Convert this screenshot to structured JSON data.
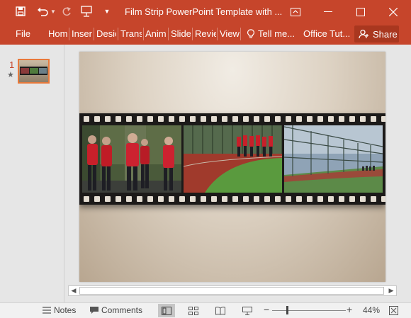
{
  "window": {
    "title": "Film Strip PowerPoint Template with ...",
    "colors": {
      "accent": "#c6452b",
      "share_bg": "#a9371f",
      "thumb_border": "#e8793b"
    },
    "controls": [
      "ribbon-display-options-icon",
      "minimize-icon",
      "maximize-icon",
      "close-icon"
    ]
  },
  "quick_access": [
    "save-icon",
    "undo-icon",
    "redo-icon",
    "start-from-beginning-icon",
    "customize-icon"
  ],
  "ribbon": {
    "tabs": [
      "File",
      "Hom",
      "Inser",
      "Desic",
      "Trans",
      "Anim",
      "Slide",
      "Revie",
      "View"
    ],
    "tell_me": "Tell me...",
    "office_tutorials": "Office Tut...",
    "share": "Share"
  },
  "thumbnails": [
    {
      "number": "1",
      "has_animation": true,
      "selected": true
    }
  ],
  "slide": {
    "frames": [
      {
        "scene": "runners-portrait"
      },
      {
        "scene": "track-field"
      },
      {
        "scene": "fence-perspective"
      }
    ]
  },
  "statusbar": {
    "notes": "Notes",
    "comments": "Comments",
    "views": [
      "normal-view",
      "slide-sorter-view",
      "reading-view",
      "slide-show-view"
    ],
    "active_view": "normal-view",
    "zoom_out": "−",
    "zoom_in": "+",
    "zoom_percent": 44,
    "zoom_label": "44%"
  }
}
